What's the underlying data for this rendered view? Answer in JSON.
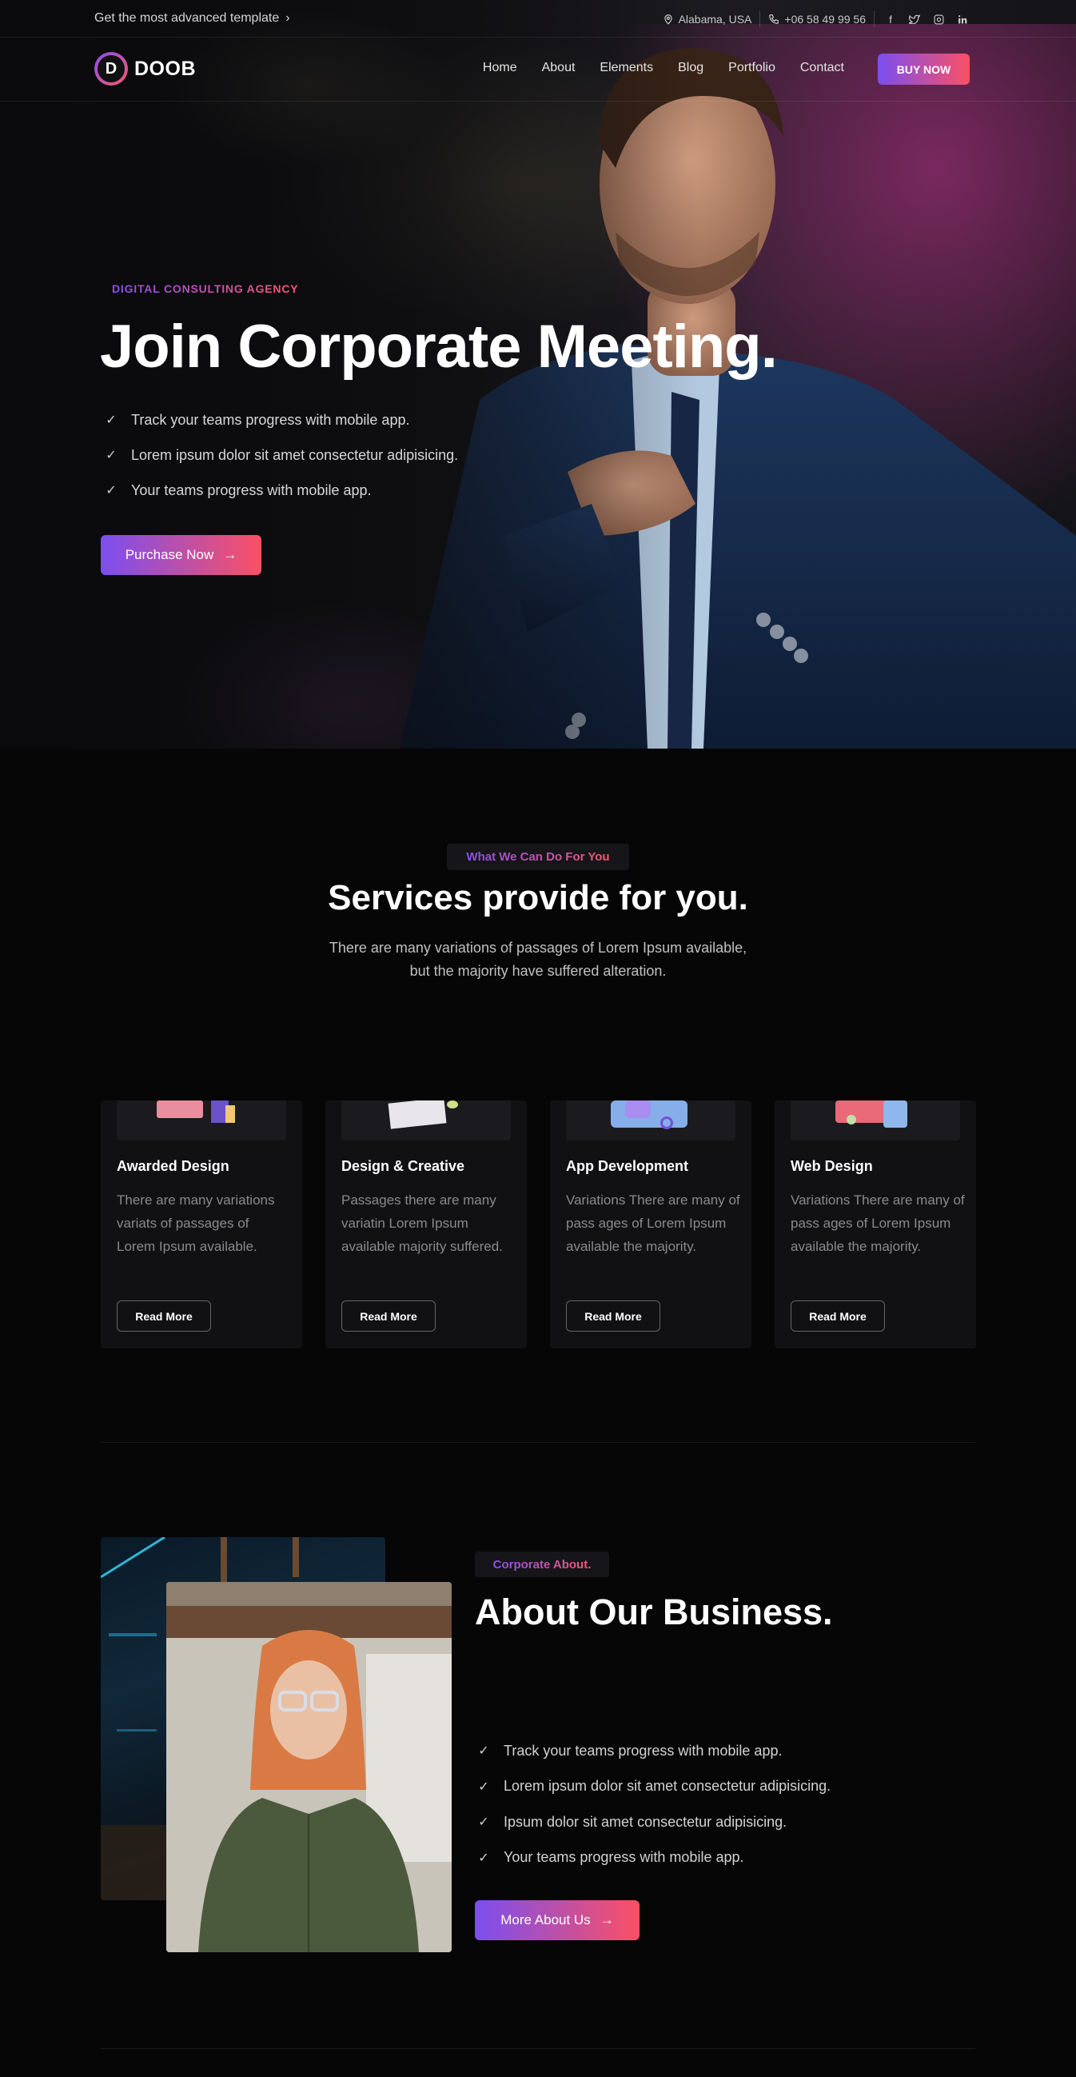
{
  "topbar": {
    "promo_text": "Get the most advanced template",
    "location": "Alabama, USA",
    "phone": "+06 58 49 99 56",
    "social_icons": [
      "facebook-icon",
      "twitter-icon",
      "instagram-icon",
      "linkedin-icon"
    ]
  },
  "brand": {
    "logo_letter": "D",
    "name": "DOOB"
  },
  "nav": {
    "items": [
      "Home",
      "About",
      "Elements",
      "Blog",
      "Portfolio",
      "Contact"
    ],
    "cta": "BUY NOW"
  },
  "hero": {
    "eyebrow": "DIGITAL CONSULTING AGENCY",
    "title": "Join Corporate Meeting.",
    "features": [
      "Track your teams progress with mobile app.",
      "Lorem ipsum dolor sit amet consectetur adipisicing.",
      "Your teams progress with mobile app."
    ],
    "button": "Purchase Now"
  },
  "services": {
    "eyebrow": "What We Can Do For You",
    "title": "Services provide for you.",
    "description_line1": "There are many variations of passages of Lorem Ipsum available,",
    "description_line2": "but the majority have suffered alteration.",
    "cards": [
      {
        "title": "Awarded Design",
        "text": "There are many variations variats of passages of Lorem Ipsum available.",
        "button": "Read More"
      },
      {
        "title": "Design & Creative",
        "text": "Passages there are many variatin Lorem Ipsum available majority suffered.",
        "button": "Read More"
      },
      {
        "title": "App Development",
        "text": "Variations There are many of pass ages of Lorem Ipsum available the majority.",
        "button": "Read More"
      },
      {
        "title": "Web Design",
        "text": "Variations There are many of pass ages of Lorem Ipsum available the majority.",
        "button": "Read More"
      }
    ]
  },
  "about": {
    "eyebrow": "Corporate About.",
    "title": "About Our Business.",
    "features": [
      "Track your teams progress with mobile app.",
      "Lorem ipsum dolor sit amet consectetur adipisicing.",
      "Ipsum dolor sit amet consectetur adipisicing.",
      "Your teams progress with mobile app."
    ],
    "button": "More About Us"
  },
  "colors": {
    "accent_start": "#7a4ff0",
    "accent_end": "#fb5064",
    "background": "#060607",
    "card": "#111114"
  }
}
